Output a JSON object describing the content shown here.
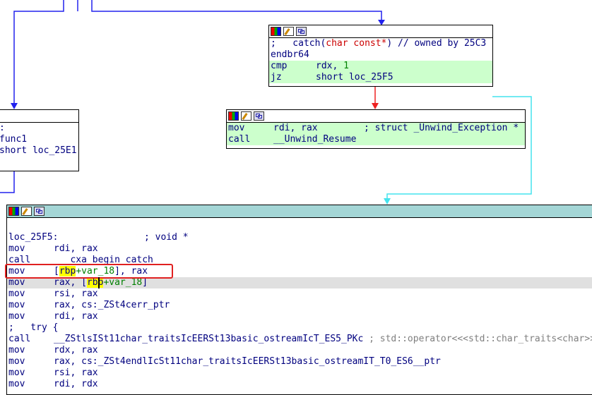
{
  "node_top": {
    "header_icons": [
      "colors-icon",
      "edit-icon",
      "graph-icon"
    ],
    "lines": [
      {
        "text": ";   catch(",
        "type": "char const*",
        "rest": ") // owned by 25C3"
      },
      {
        "text": "endbr64"
      },
      {
        "mnem": "cmp",
        "ops": "rdx, ",
        "imm": "1"
      },
      {
        "mnem": "jz",
        "ops": "short loc_25F5"
      }
    ]
  },
  "node_left": {
    "lines": [
      {
        "text": ":"
      },
      {
        "text": "func1"
      },
      {
        "text": "short loc_25E1"
      }
    ]
  },
  "node_mid": {
    "lines": [
      {
        "mnem": "mov",
        "ops": "rdi, rax",
        "comment": "; struct _Unwind_Exception *"
      },
      {
        "mnem": "call",
        "ops": "__Unwind_Resume"
      }
    ]
  },
  "node_main": {
    "label": "loc_25F5:",
    "label_comment": "; void *",
    "lines": [
      {
        "mnem": "mov",
        "ops": "rdi, rax"
      },
      {
        "mnem": "call",
        "ops": "___cxa_begin_catch"
      },
      {
        "mnem": "mov",
        "pre": "[",
        "reg": "rbp",
        "var": "+var_18",
        "post": "], rax"
      },
      {
        "mnem": "mov",
        "pre": "rax, [",
        "reg": "rbp",
        "var": "+var_18",
        "post": "]"
      },
      {
        "mnem": "mov",
        "ops": "rsi, rax"
      },
      {
        "mnem": "mov",
        "ops": "rax, cs:_ZSt4cerr_ptr"
      },
      {
        "mnem": "mov",
        "ops": "rdi, rax"
      },
      {
        "text": ";   try {"
      },
      {
        "mnem": "call",
        "ops": "__ZStlsISt11char_traitsIcEERSt13basic_ostreamIcT_ES5_PKc",
        "comment": "; std::operator<<<std::char_traits<char>>"
      },
      {
        "mnem": "mov",
        "ops": "rdx, rax"
      },
      {
        "mnem": "mov",
        "ops": "rax, cs:_ZSt4endlIcSt11char_traitsIcEERSt13basic_ostreamIT_T0_ES6__ptr"
      },
      {
        "mnem": "mov",
        "ops": "rsi, rax"
      },
      {
        "mnem": "mov",
        "ops": "rdi, rdx"
      }
    ]
  },
  "colors": {
    "edge_blue": "#2222ee",
    "edge_red": "#ee2222",
    "edge_cyan": "#44e4ee",
    "selection": "#e02020",
    "green_row": "#ccffcc",
    "teal_header": "#a4d6d6"
  }
}
